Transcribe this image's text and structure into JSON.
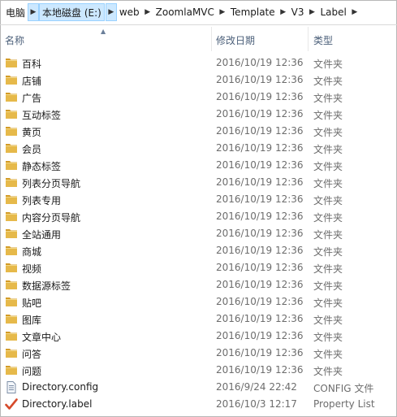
{
  "address": {
    "crumbs": [
      "电脑",
      "本地磁盘 (E:)",
      "web",
      "ZoomlaMVC",
      "Template",
      "V3",
      "Label"
    ]
  },
  "columns": {
    "name": "名称",
    "modified": "修改日期",
    "type": "类型"
  },
  "colors": {
    "folder": "#e6b94a",
    "folder_dark": "#d39b26",
    "selection": "#cce8ff"
  },
  "files": [
    {
      "name": "百科",
      "date": "2016/10/19 12:36",
      "type": "文件夹",
      "icon": "folder-icon"
    },
    {
      "name": "店铺",
      "date": "2016/10/19 12:36",
      "type": "文件夹",
      "icon": "folder-icon"
    },
    {
      "name": "广告",
      "date": "2016/10/19 12:36",
      "type": "文件夹",
      "icon": "folder-icon"
    },
    {
      "name": "互动标签",
      "date": "2016/10/19 12:36",
      "type": "文件夹",
      "icon": "folder-icon"
    },
    {
      "name": "黄页",
      "date": "2016/10/19 12:36",
      "type": "文件夹",
      "icon": "folder-icon"
    },
    {
      "name": "会员",
      "date": "2016/10/19 12:36",
      "type": "文件夹",
      "icon": "folder-icon"
    },
    {
      "name": "静态标签",
      "date": "2016/10/19 12:36",
      "type": "文件夹",
      "icon": "folder-icon"
    },
    {
      "name": "列表分页导航",
      "date": "2016/10/19 12:36",
      "type": "文件夹",
      "icon": "folder-icon"
    },
    {
      "name": "列表专用",
      "date": "2016/10/19 12:36",
      "type": "文件夹",
      "icon": "folder-icon"
    },
    {
      "name": "内容分页导航",
      "date": "2016/10/19 12:36",
      "type": "文件夹",
      "icon": "folder-icon"
    },
    {
      "name": "全站通用",
      "date": "2016/10/19 12:36",
      "type": "文件夹",
      "icon": "folder-icon"
    },
    {
      "name": "商城",
      "date": "2016/10/19 12:36",
      "type": "文件夹",
      "icon": "folder-icon"
    },
    {
      "name": "视频",
      "date": "2016/10/19 12:36",
      "type": "文件夹",
      "icon": "folder-icon"
    },
    {
      "name": "数据源标签",
      "date": "2016/10/19 12:36",
      "type": "文件夹",
      "icon": "folder-icon"
    },
    {
      "name": "贴吧",
      "date": "2016/10/19 12:36",
      "type": "文件夹",
      "icon": "folder-icon"
    },
    {
      "name": "图库",
      "date": "2016/10/19 12:36",
      "type": "文件夹",
      "icon": "folder-icon"
    },
    {
      "name": "文章中心",
      "date": "2016/10/19 12:36",
      "type": "文件夹",
      "icon": "folder-icon"
    },
    {
      "name": "问答",
      "date": "2016/10/19 12:36",
      "type": "文件夹",
      "icon": "folder-icon"
    },
    {
      "name": "问题",
      "date": "2016/10/19 12:36",
      "type": "文件夹",
      "icon": "folder-icon"
    },
    {
      "name": "Directory.config",
      "date": "2016/9/24 22:42",
      "type": "CONFIG 文件",
      "icon": "config-file-icon"
    },
    {
      "name": "Directory.label",
      "date": "2016/10/3 12:17",
      "type": "Property List",
      "icon": "checkmark-file-icon"
    }
  ]
}
